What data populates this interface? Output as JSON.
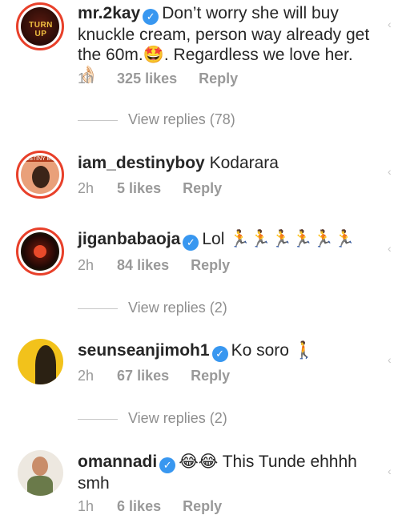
{
  "comments": [
    {
      "username": "mr.2kay",
      "verified": true,
      "text": "Don’t worry she will buy knuckle cream, person way already get the 60m.🤩. Regardless we love her. 👌🏻",
      "time": "1h",
      "likes": "325 likes",
      "reply": "Reply",
      "view_replies": "View replies (78)",
      "avatar_label": "TURN UP"
    },
    {
      "username": "iam_destinyboy",
      "verified": false,
      "text": "Kodarara",
      "time": "2h",
      "likes": "5 likes",
      "reply": "Reply",
      "avatar_label": "DESTINY BOY"
    },
    {
      "username": "jiganbabaoja",
      "verified": true,
      "text": "Lol 🏃🏃🏃🏃🏃🏃",
      "time": "2h",
      "likes": "84 likes",
      "reply": "Reply",
      "view_replies": "View replies (2)"
    },
    {
      "username": "seunseanjimoh1",
      "verified": true,
      "text": "Ko soro 🚶",
      "time": "2h",
      "likes": "67 likes",
      "reply": "Reply",
      "view_replies": "View replies (2)"
    },
    {
      "username": "omannadi",
      "verified": true,
      "text": "😂😂 This Tunde ehhhh smh",
      "time": "1h",
      "likes": "6 likes",
      "reply": "Reply"
    }
  ],
  "icons": {
    "heart": "heart-outline-icon",
    "verified": "verified-badge-icon"
  },
  "colors": {
    "verified": "#3897f0",
    "story_ring": "#e8402a",
    "meta": "#999999"
  }
}
